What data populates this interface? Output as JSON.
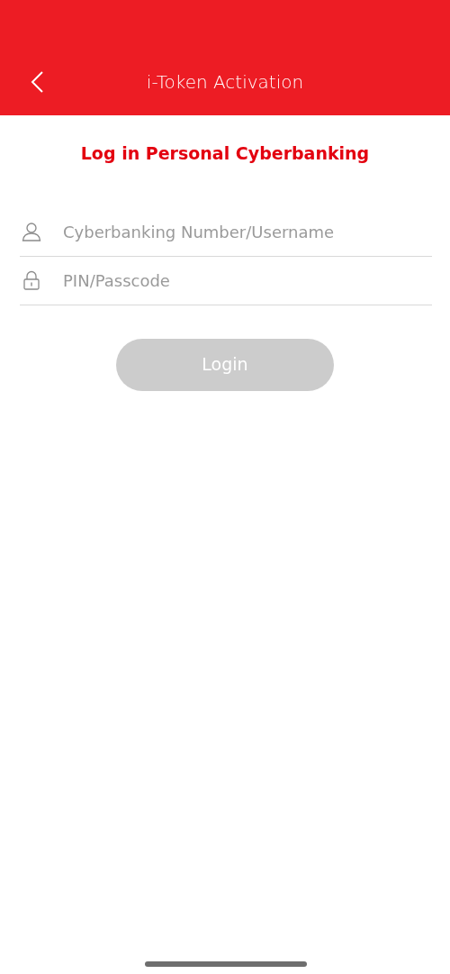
{
  "header": {
    "title": "i-Token Activation"
  },
  "heading": "Log in Personal Cyberbanking",
  "fields": [
    {
      "kind": "user",
      "placeholder": "Cyberbanking Number/Username"
    },
    {
      "kind": "lock",
      "placeholder": "PIN/Passcode"
    }
  ],
  "login_button": {
    "label": "Login",
    "disabled": true
  }
}
